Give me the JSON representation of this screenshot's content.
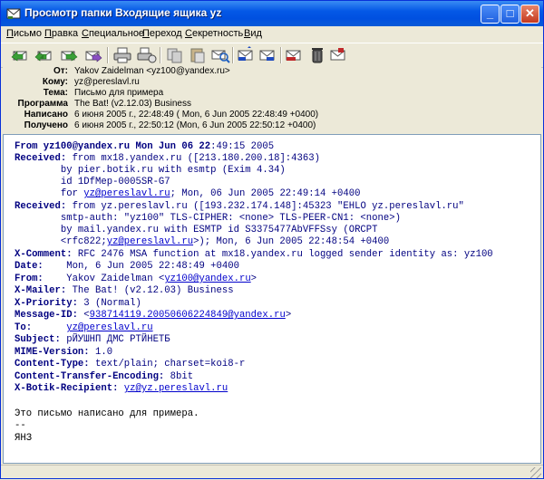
{
  "window": {
    "title": "Просмотр папки Входящие ящика yz",
    "btn_min": "_",
    "btn_max": "□",
    "btn_close": "✕"
  },
  "menu": [
    {
      "label": "Письмо",
      "u": "П",
      "rest": "исьмо"
    },
    {
      "label": "Правка",
      "u": "П",
      "rest": "равка"
    },
    {
      "label": "Специальное",
      "u": "С",
      "rest": "пециальное"
    },
    {
      "label": "Переход",
      "u": "П",
      "rest": "ереход"
    },
    {
      "label": "Секретность",
      "u": "С",
      "rest": "екретность"
    },
    {
      "label": "Вид",
      "u": "В",
      "rest": "ид"
    }
  ],
  "toolbar": {
    "icons": [
      "reply-icon",
      "reply-all-icon",
      "forward-icon",
      "redirect-icon",
      "print-icon",
      "print-setup-icon",
      "copy-icon",
      "paste-icon",
      "find-icon",
      "previous-message-icon",
      "next-message-icon",
      "delete-icon",
      "trash-icon",
      "mark-read-icon"
    ]
  },
  "headers": [
    {
      "label": "От:",
      "value": "Yakov Zaidelman <yz100@yandex.ru>"
    },
    {
      "label": "Кому:",
      "value": "yz@pereslavl.ru"
    },
    {
      "label": "Тема:",
      "value": "Письмо для примера"
    },
    {
      "label": "Программа",
      "value": "The Bat! (v2.12.03) Business"
    },
    {
      "label": "Написано",
      "value": "6 июня 2005 г., 22:48:49  ( Mon, 6 Jun 2005 22:48:49 +0400)"
    },
    {
      "label": "Получено",
      "value": "6 июня 2005 г., 22:50:12  (Mon, 6 Jun 2005 22:50:12 +0400)"
    }
  ],
  "source": {
    "from_line": {
      "label": "From yz100@yandex.ru Mon Jun 06 22",
      "rest": ":49:15 2005"
    },
    "received1": {
      "label": "Received:",
      "l1": " from mx18.yandex.ru ([213.180.200.18]:4363)",
      "l2": "        by pier.botik.ru with esmtp (Exim 4.34)",
      "l3": "        id 1DfMep-0005SR-G7",
      "l4a": "        for ",
      "l4link": "yz@pereslavl.ru",
      "l4b": "; Mon, 06 Jun 2005 22:49:14 +0400"
    },
    "received2": {
      "label": "Received:",
      "l1": " from yz.pereslavl.ru ([193.232.174.148]:45323 \"EHLO yz.pereslavl.ru\"",
      "l2": "        smtp-auth: \"yz100\" TLS-CIPHER: <none> TLS-PEER-CN1: <none>)",
      "l3": "        by mail.yandex.ru with ESMTP id S3375477AbVFFSsy (ORCPT",
      "l4a": "        <rfc822;",
      "l4link": "yz@pereslavl.ru",
      "l4b": ">); Mon, 6 Jun 2005 22:48:54 +0400"
    },
    "xcomment": {
      "label": "X-Comment:",
      "value": " RFC 2476 MSA function at mx18.yandex.ru logged sender identity as: yz100"
    },
    "date": {
      "label": "Date:",
      "value": "    Mon, 6 Jun 2005 22:48:49 +0400"
    },
    "from": {
      "label": "From:",
      "value_a": "    Yakov Zaidelman <",
      "link": "yz100@yandex.ru",
      "value_b": ">"
    },
    "xmailer": {
      "label": "X-Mailer:",
      "value": " The Bat! (v2.12.03) Business"
    },
    "xpriority": {
      "label": "X-Priority:",
      "value": " 3 (Normal)"
    },
    "messageid": {
      "label": "Message-ID:",
      "value_a": " <",
      "link": "938714119.20050606224849@yandex.ru",
      "value_b": ">"
    },
    "to": {
      "label": "To:",
      "value_a": "      ",
      "link": "yz@pereslavl.ru"
    },
    "subject": {
      "label": "Subject:",
      "value": " рЙУШНП ДМС РТЙНЕТБ"
    },
    "mime": {
      "label": "MIME-Version:",
      "value": " 1.0"
    },
    "ctype": {
      "label": "Content-Type:",
      "value": " text/plain; charset=koi8-r"
    },
    "cte": {
      "label": "Content-Transfer-Encoding:",
      "value": " 8bit"
    },
    "xbotik": {
      "label": "X-Botik-Recipient:",
      "value_a": " ",
      "link": "yz@yz.pereslavl.ru"
    },
    "body_line1": "Это письмо написано для примера.",
    "body_line2": "--",
    "body_line3": "ЯНЗ"
  }
}
